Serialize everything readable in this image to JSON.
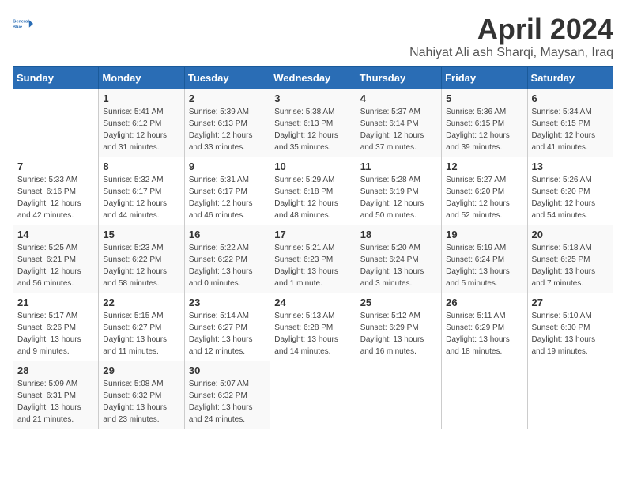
{
  "header": {
    "logo_line1": "General",
    "logo_line2": "Blue",
    "month": "April 2024",
    "location": "Nahiyat Ali ash Sharqi, Maysan, Iraq"
  },
  "days_of_week": [
    "Sunday",
    "Monday",
    "Tuesday",
    "Wednesday",
    "Thursday",
    "Friday",
    "Saturday"
  ],
  "weeks": [
    [
      {
        "day": "",
        "sunrise": "",
        "sunset": "",
        "daylight": ""
      },
      {
        "day": "1",
        "sunrise": "Sunrise: 5:41 AM",
        "sunset": "Sunset: 6:12 PM",
        "daylight": "Daylight: 12 hours and 31 minutes."
      },
      {
        "day": "2",
        "sunrise": "Sunrise: 5:39 AM",
        "sunset": "Sunset: 6:13 PM",
        "daylight": "Daylight: 12 hours and 33 minutes."
      },
      {
        "day": "3",
        "sunrise": "Sunrise: 5:38 AM",
        "sunset": "Sunset: 6:13 PM",
        "daylight": "Daylight: 12 hours and 35 minutes."
      },
      {
        "day": "4",
        "sunrise": "Sunrise: 5:37 AM",
        "sunset": "Sunset: 6:14 PM",
        "daylight": "Daylight: 12 hours and 37 minutes."
      },
      {
        "day": "5",
        "sunrise": "Sunrise: 5:36 AM",
        "sunset": "Sunset: 6:15 PM",
        "daylight": "Daylight: 12 hours and 39 minutes."
      },
      {
        "day": "6",
        "sunrise": "Sunrise: 5:34 AM",
        "sunset": "Sunset: 6:15 PM",
        "daylight": "Daylight: 12 hours and 41 minutes."
      }
    ],
    [
      {
        "day": "7",
        "sunrise": "Sunrise: 5:33 AM",
        "sunset": "Sunset: 6:16 PM",
        "daylight": "Daylight: 12 hours and 42 minutes."
      },
      {
        "day": "8",
        "sunrise": "Sunrise: 5:32 AM",
        "sunset": "Sunset: 6:17 PM",
        "daylight": "Daylight: 12 hours and 44 minutes."
      },
      {
        "day": "9",
        "sunrise": "Sunrise: 5:31 AM",
        "sunset": "Sunset: 6:17 PM",
        "daylight": "Daylight: 12 hours and 46 minutes."
      },
      {
        "day": "10",
        "sunrise": "Sunrise: 5:29 AM",
        "sunset": "Sunset: 6:18 PM",
        "daylight": "Daylight: 12 hours and 48 minutes."
      },
      {
        "day": "11",
        "sunrise": "Sunrise: 5:28 AM",
        "sunset": "Sunset: 6:19 PM",
        "daylight": "Daylight: 12 hours and 50 minutes."
      },
      {
        "day": "12",
        "sunrise": "Sunrise: 5:27 AM",
        "sunset": "Sunset: 6:20 PM",
        "daylight": "Daylight: 12 hours and 52 minutes."
      },
      {
        "day": "13",
        "sunrise": "Sunrise: 5:26 AM",
        "sunset": "Sunset: 6:20 PM",
        "daylight": "Daylight: 12 hours and 54 minutes."
      }
    ],
    [
      {
        "day": "14",
        "sunrise": "Sunrise: 5:25 AM",
        "sunset": "Sunset: 6:21 PM",
        "daylight": "Daylight: 12 hours and 56 minutes."
      },
      {
        "day": "15",
        "sunrise": "Sunrise: 5:23 AM",
        "sunset": "Sunset: 6:22 PM",
        "daylight": "Daylight: 12 hours and 58 minutes."
      },
      {
        "day": "16",
        "sunrise": "Sunrise: 5:22 AM",
        "sunset": "Sunset: 6:22 PM",
        "daylight": "Daylight: 13 hours and 0 minutes."
      },
      {
        "day": "17",
        "sunrise": "Sunrise: 5:21 AM",
        "sunset": "Sunset: 6:23 PM",
        "daylight": "Daylight: 13 hours and 1 minute."
      },
      {
        "day": "18",
        "sunrise": "Sunrise: 5:20 AM",
        "sunset": "Sunset: 6:24 PM",
        "daylight": "Daylight: 13 hours and 3 minutes."
      },
      {
        "day": "19",
        "sunrise": "Sunrise: 5:19 AM",
        "sunset": "Sunset: 6:24 PM",
        "daylight": "Daylight: 13 hours and 5 minutes."
      },
      {
        "day": "20",
        "sunrise": "Sunrise: 5:18 AM",
        "sunset": "Sunset: 6:25 PM",
        "daylight": "Daylight: 13 hours and 7 minutes."
      }
    ],
    [
      {
        "day": "21",
        "sunrise": "Sunrise: 5:17 AM",
        "sunset": "Sunset: 6:26 PM",
        "daylight": "Daylight: 13 hours and 9 minutes."
      },
      {
        "day": "22",
        "sunrise": "Sunrise: 5:15 AM",
        "sunset": "Sunset: 6:27 PM",
        "daylight": "Daylight: 13 hours and 11 minutes."
      },
      {
        "day": "23",
        "sunrise": "Sunrise: 5:14 AM",
        "sunset": "Sunset: 6:27 PM",
        "daylight": "Daylight: 13 hours and 12 minutes."
      },
      {
        "day": "24",
        "sunrise": "Sunrise: 5:13 AM",
        "sunset": "Sunset: 6:28 PM",
        "daylight": "Daylight: 13 hours and 14 minutes."
      },
      {
        "day": "25",
        "sunrise": "Sunrise: 5:12 AM",
        "sunset": "Sunset: 6:29 PM",
        "daylight": "Daylight: 13 hours and 16 minutes."
      },
      {
        "day": "26",
        "sunrise": "Sunrise: 5:11 AM",
        "sunset": "Sunset: 6:29 PM",
        "daylight": "Daylight: 13 hours and 18 minutes."
      },
      {
        "day": "27",
        "sunrise": "Sunrise: 5:10 AM",
        "sunset": "Sunset: 6:30 PM",
        "daylight": "Daylight: 13 hours and 19 minutes."
      }
    ],
    [
      {
        "day": "28",
        "sunrise": "Sunrise: 5:09 AM",
        "sunset": "Sunset: 6:31 PM",
        "daylight": "Daylight: 13 hours and 21 minutes."
      },
      {
        "day": "29",
        "sunrise": "Sunrise: 5:08 AM",
        "sunset": "Sunset: 6:32 PM",
        "daylight": "Daylight: 13 hours and 23 minutes."
      },
      {
        "day": "30",
        "sunrise": "Sunrise: 5:07 AM",
        "sunset": "Sunset: 6:32 PM",
        "daylight": "Daylight: 13 hours and 24 minutes."
      },
      {
        "day": "",
        "sunrise": "",
        "sunset": "",
        "daylight": ""
      },
      {
        "day": "",
        "sunrise": "",
        "sunset": "",
        "daylight": ""
      },
      {
        "day": "",
        "sunrise": "",
        "sunset": "",
        "daylight": ""
      },
      {
        "day": "",
        "sunrise": "",
        "sunset": "",
        "daylight": ""
      }
    ]
  ]
}
